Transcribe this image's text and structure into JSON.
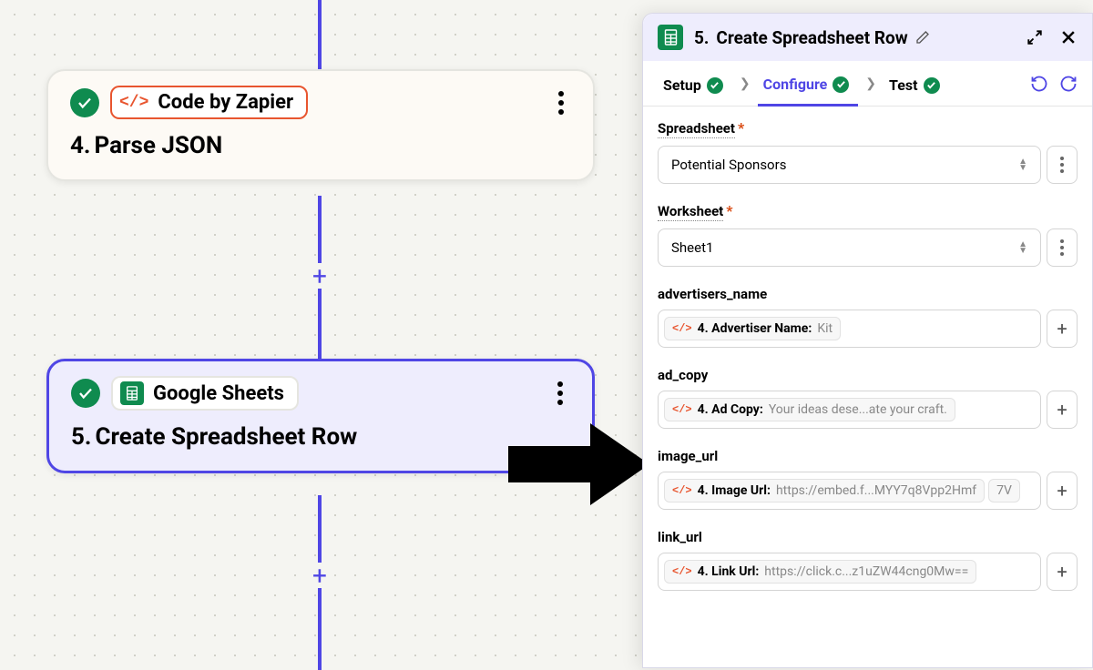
{
  "canvas": {
    "step4": {
      "app_label": "Code by Zapier",
      "number": "4.",
      "title": "Parse JSON"
    },
    "step5": {
      "app_label": "Google Sheets",
      "number": "5.",
      "title": "Create Spreadsheet Row"
    }
  },
  "panel": {
    "header": {
      "number": "5.",
      "title": "Create Spreadsheet Row"
    },
    "tabs": {
      "setup": "Setup",
      "configure": "Configure",
      "test": "Test"
    },
    "fields": {
      "spreadsheet": {
        "label": "Spreadsheet",
        "value": "Potential Sponsors"
      },
      "worksheet": {
        "label": "Worksheet",
        "value": "Sheet1"
      },
      "advertisers_name": {
        "label": "advertisers_name",
        "ref": "4. Advertiser Name:",
        "val": "Kit"
      },
      "ad_copy": {
        "label": "ad_copy",
        "ref": "4. Ad Copy:",
        "val": "Your ideas dese...ate your craft."
      },
      "image_url": {
        "label": "image_url",
        "ref": "4. Image Url:",
        "val": "https://embed.f...MYY7q8Vpp2Hmf",
        "overflow": "7V"
      },
      "link_url": {
        "label": "link_url",
        "ref": "4. Link Url:",
        "val": "https://click.c...z1uZW44cng0Mw=="
      }
    }
  }
}
